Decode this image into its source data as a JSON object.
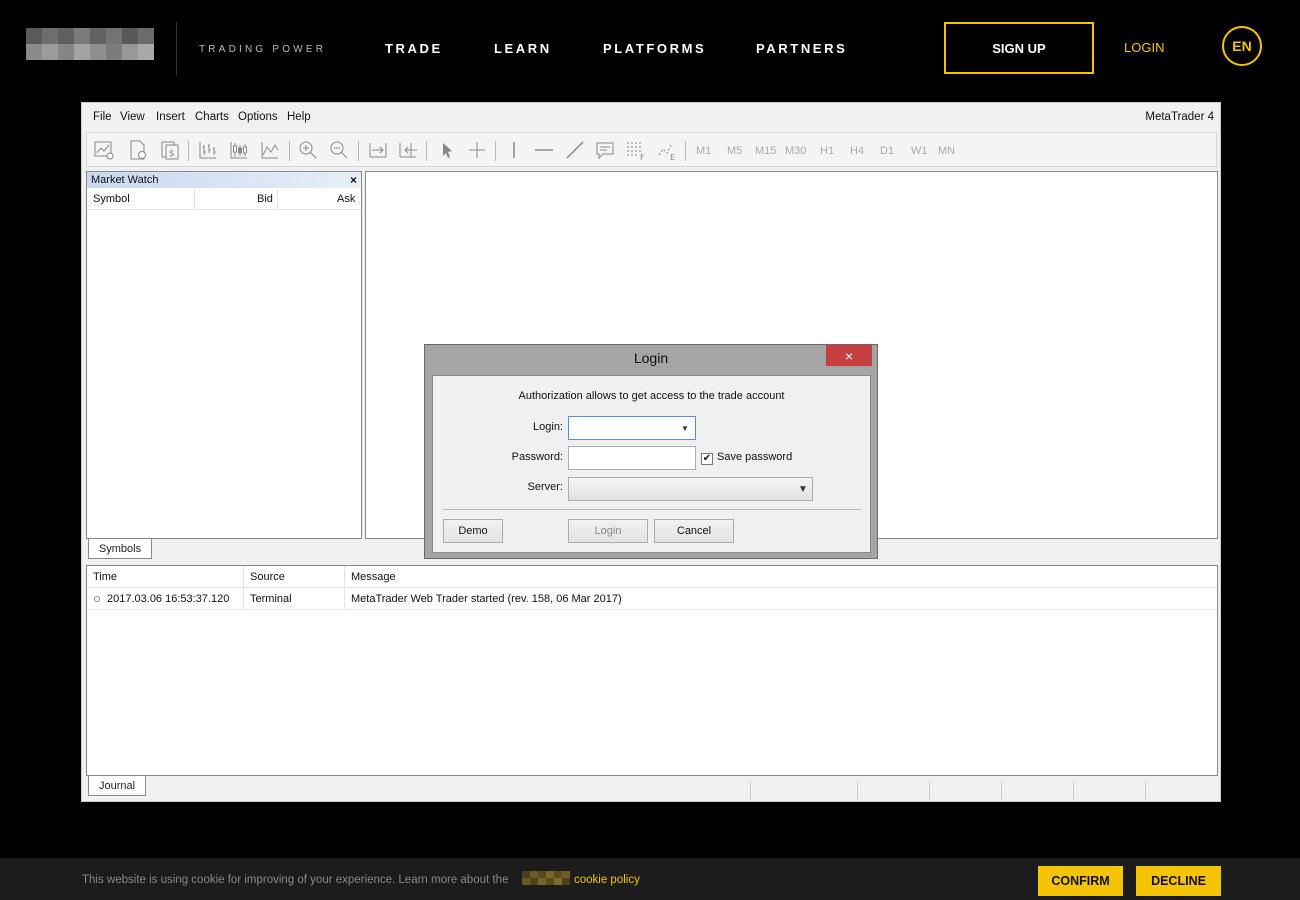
{
  "header": {
    "tagline": "TRADING POWER",
    "nav": [
      "TRADE",
      "LEARN",
      "PLATFORMS",
      "PARTNERS"
    ],
    "signup_label": "SIGN UP",
    "login_label": "LOGIN",
    "language": "EN",
    "accent_color": "#f5c400"
  },
  "terminal": {
    "menu": [
      "File",
      "View",
      "Insert",
      "Charts",
      "Options",
      "Help"
    ],
    "app_title": "MetaTrader 4",
    "timeframes": [
      "M1",
      "M5",
      "M15",
      "M30",
      "H1",
      "H4",
      "D1",
      "W1",
      "MN"
    ],
    "market_watch": {
      "title": "Market Watch",
      "close": "×",
      "columns": [
        "Symbol",
        "Bid",
        "Ask"
      ],
      "tab": "Symbols"
    },
    "journal": {
      "columns": [
        "Time",
        "Source",
        "Message"
      ],
      "rows": [
        {
          "time": "2017.03.06 16:53:37.120",
          "source": "Terminal",
          "message": "MetaTrader Web Trader started (rev. 158, 06 Mar 2017)"
        }
      ],
      "tab": "Journal"
    }
  },
  "dialog": {
    "title": "Login",
    "close": "×",
    "message": "Authorization allows to get access to the trade account",
    "login_label": "Login:",
    "password_label": "Password:",
    "server_label": "Server:",
    "save_password_label": "Save password",
    "save_password_checked": "✔",
    "demo_button": "Demo",
    "login_button": "Login",
    "cancel_button": "Cancel"
  },
  "cookie": {
    "text": "This website is using cookie for improving of your experience. Learn more about the",
    "link": "cookie policy",
    "confirm": "CONFIRM",
    "decline": "DECLINE"
  }
}
